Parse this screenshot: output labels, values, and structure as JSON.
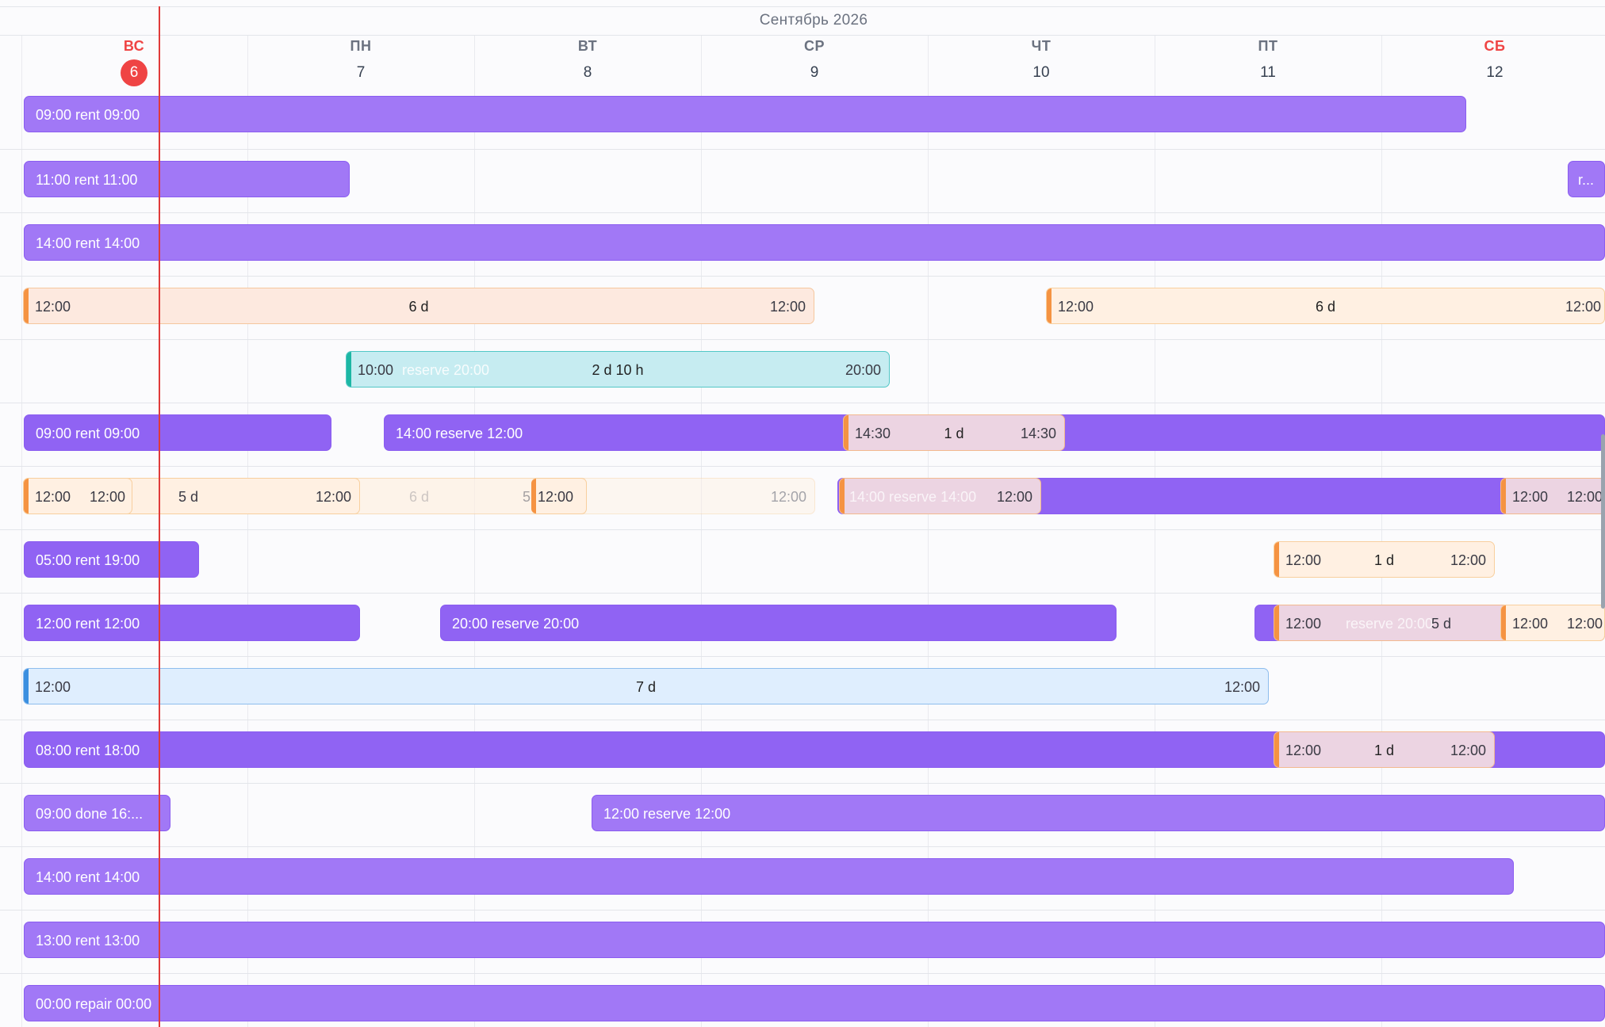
{
  "calendar": {
    "month": "Сентябрь 2026",
    "days": [
      {
        "name": "ВС",
        "num": "6"
      },
      {
        "name": "ПН",
        "num": "7"
      },
      {
        "name": "ВТ",
        "num": "8"
      },
      {
        "name": "СР",
        "num": "9"
      },
      {
        "name": "ЧТ",
        "num": "10"
      },
      {
        "name": "ПТ",
        "num": "11"
      },
      {
        "name": "СБ",
        "num": "12"
      }
    ]
  },
  "rows": [
    {
      "bars": [
        {
          "kind": "rent",
          "label": "09:00 rent 09:00"
        }
      ]
    },
    {
      "bars": [
        {
          "kind": "rent",
          "label": "11:00 rent 11:00"
        },
        {
          "kind": "rent",
          "label": "r..."
        }
      ]
    },
    {
      "bars": [
        {
          "kind": "rent",
          "label": "14:00 rent 14:00"
        }
      ]
    },
    {
      "bars": [
        {
          "kind": "booking",
          "start": "12:00",
          "mid": "6 d",
          "end": "12:00"
        },
        {
          "kind": "booking",
          "start": "12:00",
          "mid": "6 d",
          "end": "12:00"
        }
      ]
    },
    {
      "bars": [
        {
          "kind": "booking",
          "start": "10:00",
          "mid": "2 d 10 h",
          "end": "20:00",
          "ghost": "reserve 20:00"
        }
      ]
    },
    {
      "bars": [
        {
          "kind": "rent",
          "label": "09:00 rent 09:00"
        },
        {
          "kind": "rent",
          "label": "14:00 reserve 12:00"
        },
        {
          "kind": "booking",
          "start": "14:30",
          "mid": "1 d",
          "end": "14:30"
        }
      ]
    },
    {
      "bars": [
        {
          "kind": "booking",
          "start": "12:00",
          "end": "12:00"
        },
        {
          "kind": "booking",
          "start": "12:00",
          "mid": "5 d",
          "end": "12:00"
        },
        {
          "kind": "booking",
          "mid": "6 d",
          "end": "12:00"
        },
        {
          "kind": "booking",
          "mid": "5 d",
          "end": "12:00"
        },
        {
          "kind": "booking",
          "label": "14:00 reserve 14:00",
          "end": "12:00"
        },
        {
          "kind": "booking",
          "start": "12:00",
          "end": "12:00"
        }
      ]
    },
    {
      "bars": [
        {
          "kind": "rent",
          "label": "05:00 rent 19:00"
        },
        {
          "kind": "booking",
          "start": "12:00",
          "mid": "1 d",
          "end": "12:00"
        }
      ]
    },
    {
      "bars": [
        {
          "kind": "rent",
          "label": "12:00 rent 12:00"
        },
        {
          "kind": "rent",
          "label": "20:00 reserve 20:00"
        },
        {
          "kind": "booking",
          "start": "12:00",
          "mid": "5 d",
          "ghost": "reserve 20:00"
        },
        {
          "kind": "booking",
          "start": "12:00",
          "end": "12:00"
        }
      ]
    },
    {
      "bars": [
        {
          "kind": "booking",
          "start": "12:00",
          "mid": "7 d",
          "end": "12:00"
        }
      ]
    },
    {
      "bars": [
        {
          "kind": "rent",
          "label": "08:00 rent 18:00"
        },
        {
          "kind": "booking",
          "start": "12:00",
          "mid": "1 d",
          "end": "12:00"
        }
      ]
    },
    {
      "bars": [
        {
          "kind": "rent",
          "label": "09:00 done 16:..."
        },
        {
          "kind": "rent",
          "label": "12:00 reserve 12:00"
        }
      ]
    },
    {
      "bars": [
        {
          "kind": "rent",
          "label": "14:00 rent 14:00"
        }
      ]
    },
    {
      "bars": [
        {
          "kind": "rent",
          "label": "13:00 rent 13:00"
        }
      ]
    },
    {
      "bars": [
        {
          "kind": "rent",
          "label": "00:00 repair 00:00"
        }
      ]
    }
  ]
}
